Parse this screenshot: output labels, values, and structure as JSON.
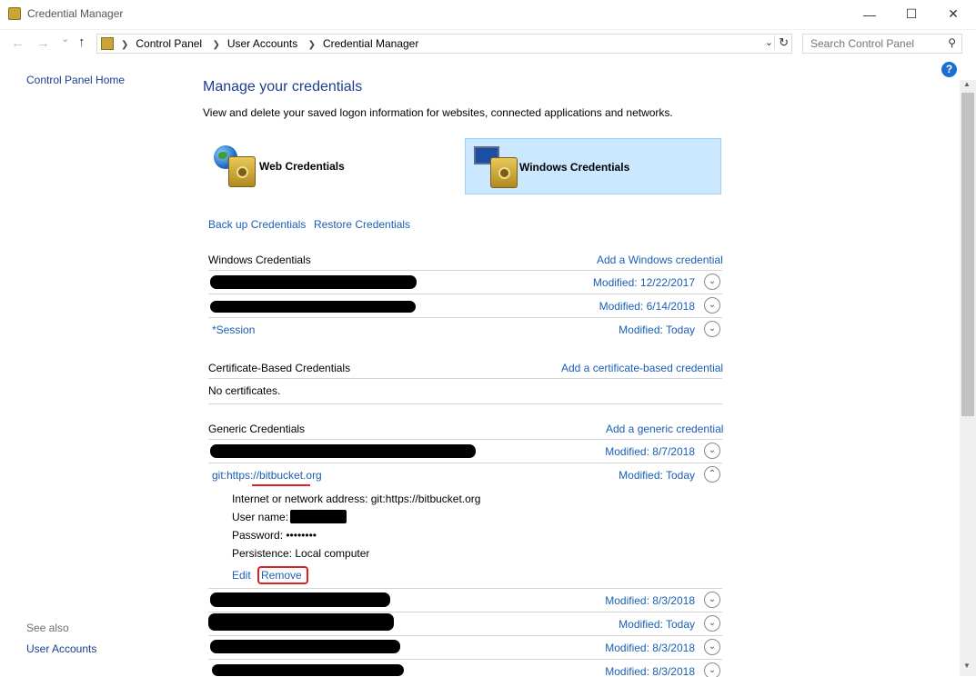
{
  "window": {
    "title": "Credential Manager",
    "minimize": "—",
    "maximize": "☐",
    "close": "✕"
  },
  "nav": {
    "back": "←",
    "forward": "→",
    "recent": "⌄",
    "up": "↑"
  },
  "breadcrumbs": [
    "Control Panel",
    "User Accounts",
    "Credential Manager"
  ],
  "search": {
    "placeholder": "Search Control Panel"
  },
  "help": "?",
  "sidebar": {
    "home": "Control Panel Home",
    "see_also": "See also",
    "user_accounts": "User Accounts"
  },
  "main": {
    "title": "Manage your credentials",
    "description": "View and delete your saved logon information for websites, connected applications and networks.",
    "tiles": {
      "web": "Web Credentials",
      "windows": "Windows Credentials"
    },
    "backup": "Back up Credentials",
    "restore": "Restore Credentials"
  },
  "windows_section": {
    "title": "Windows Credentials",
    "add": "Add a Windows credential",
    "rows": [
      {
        "name": "",
        "modified": "Modified:  12/22/2017"
      },
      {
        "name": "",
        "modified": "Modified:  6/14/2018"
      },
      {
        "name": "*Session",
        "modified": "Modified:  Today"
      }
    ]
  },
  "cert_section": {
    "title": "Certificate-Based Credentials",
    "add": "Add a certificate-based credential",
    "empty": "No certificates."
  },
  "generic_section": {
    "title": "Generic Credentials",
    "add": "Add a generic credential",
    "rows": [
      {
        "name": "",
        "modified": "Modified:  8/7/2018"
      },
      {
        "name": "git:https://bitbucket.org",
        "modified": "Modified:  Today"
      },
      {
        "name": "",
        "modified": "Modified:  8/3/2018"
      },
      {
        "name": "",
        "modified": "Modified:  Today"
      },
      {
        "name": "",
        "modified": "Modified:  8/3/2018"
      },
      {
        "name": "",
        "modified": "Modified:  8/3/2018"
      }
    ],
    "details": {
      "address": "Internet or network address:  git:https://bitbucket.org",
      "username": "User name:",
      "password": "Password:  ••••••••",
      "persistence": "Persistence:  Local computer",
      "edit": "Edit",
      "remove": "Remove"
    }
  }
}
